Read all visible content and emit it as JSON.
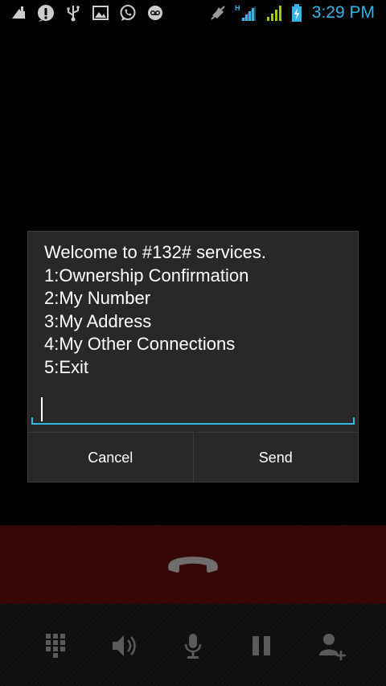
{
  "status_bar": {
    "time": "3:29 PM",
    "network_type": "H",
    "left_icons": [
      "drive-icon",
      "alert-icon",
      "usb-icon",
      "image-icon",
      "whatsapp-icon",
      "voicemail-icon"
    ],
    "right_icons": [
      "mute-icon",
      "signal-h-icon",
      "signal-icon",
      "battery-charging-icon"
    ],
    "accent_color": "#33b5e5"
  },
  "ussd_dialog": {
    "message_lines": [
      "Welcome to #132# services.",
      "1:Ownership Confirmation",
      "2:My Number",
      "3:My Address",
      "4:My Other Connections",
      "5:Exit"
    ],
    "input_value": "",
    "cancel_label": "Cancel",
    "send_label": "Send"
  },
  "call_controls": {
    "end_call_icon": "end-call-icon",
    "end_call_color": "#6e6e6e",
    "buttons": [
      "dialpad-icon",
      "speaker-icon",
      "microphone-icon",
      "hold-icon",
      "add-call-icon"
    ]
  }
}
